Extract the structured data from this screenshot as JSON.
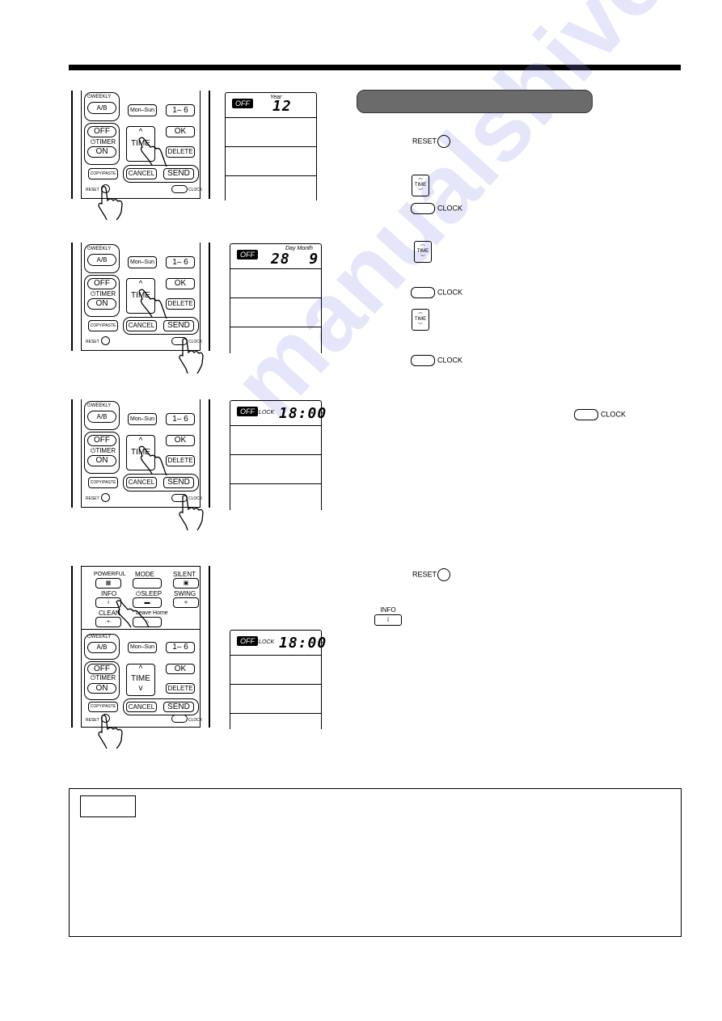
{
  "page": {
    "section_header": "",
    "watermark": "manualshive.com"
  },
  "remote": {
    "weekly_label": "⏻WEEKLY",
    "ab_label": "A/B",
    "mon_sun_label": "Mon–Sun",
    "one_six_label": "1– 6",
    "off_label": "OFF",
    "timer_label": "⏻TIMER",
    "on_label": "ON",
    "time_up": "^",
    "time_label": "TIME",
    "time_down": "v",
    "ok_label": "OK",
    "delete_label": "DELETE",
    "copy_paste_label": "COPY/PASTE",
    "cancel_label": "CANCEL",
    "send_label": "SEND",
    "reset_label": "RESET",
    "clock_label": "CLOCK",
    "powerful_label": "POWERFUL",
    "mode_label": "MODE",
    "silent_label": "SILENT",
    "info_label": "INFO",
    "sleep_label": "⏻SLEEP",
    "swing_label": "SWING",
    "clean_label": "CLEAN",
    "leave_home_label": "Leave Home",
    "info_icon": "i"
  },
  "displays": [
    {
      "badge": "OFF",
      "caption": "Year",
      "value": "12"
    },
    {
      "badge": "OFF",
      "caption": "Day Month",
      "value": "28  9"
    },
    {
      "badge": "OFF",
      "caption": "CLOCK",
      "value": "18:00"
    },
    {
      "badge": "OFF",
      "caption": "CLOCK",
      "value": "18:00"
    }
  ],
  "instructions": {
    "reset_label": "RESET",
    "time_label": "TIME",
    "clock_label": "CLOCK",
    "info_label": "INFO",
    "info_icon": "i"
  },
  "note": {
    "label": "",
    "body": ""
  }
}
